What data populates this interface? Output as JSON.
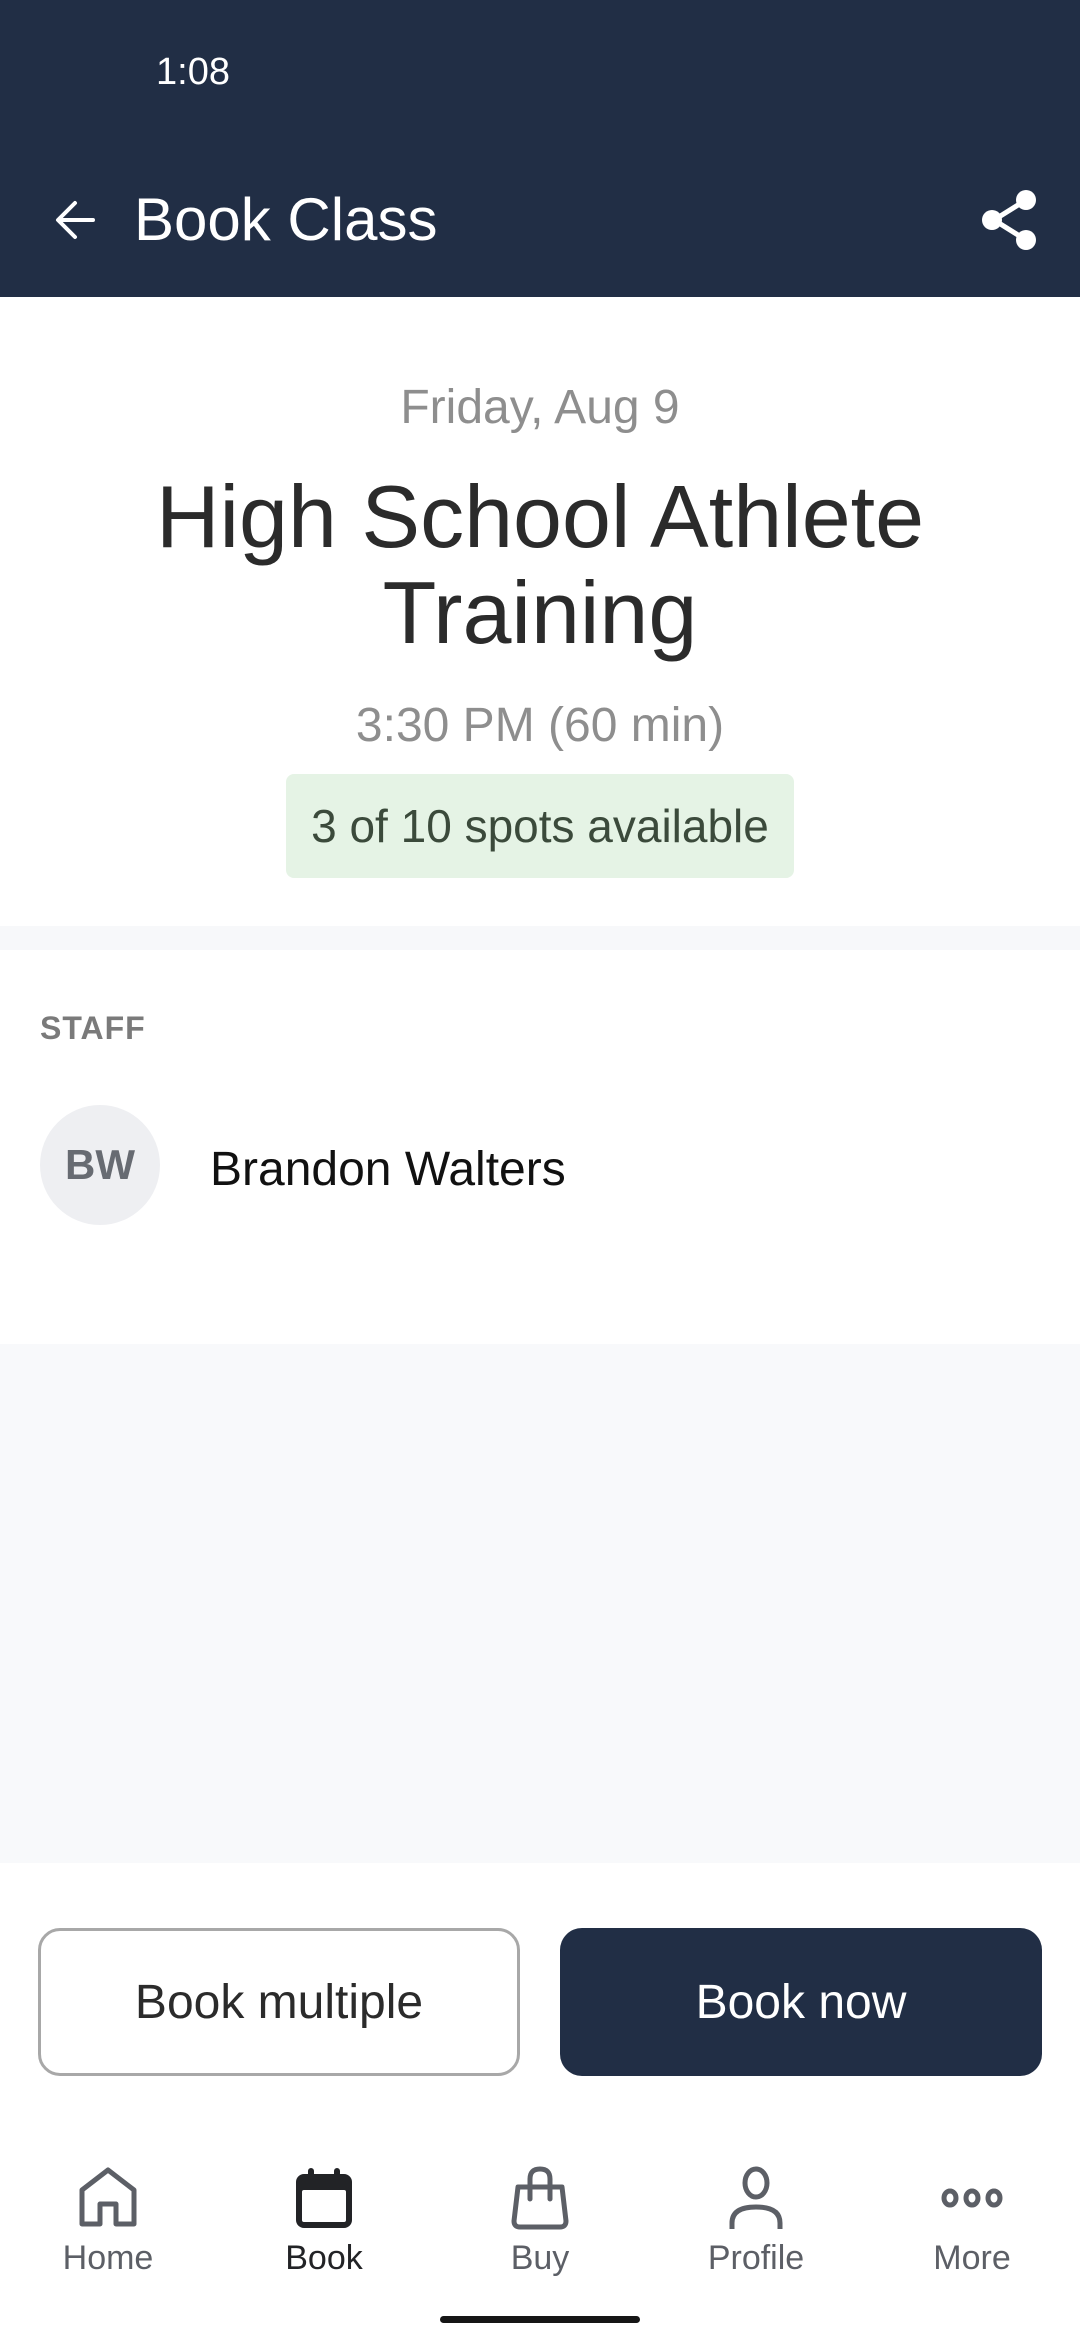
{
  "status_bar": {
    "time": "1:08"
  },
  "app_bar": {
    "title": "Book Class",
    "back_icon": "arrow-left-icon",
    "share_icon": "share-icon"
  },
  "class_info": {
    "date": "Friday, Aug 9",
    "title": "High School Athlete Training",
    "time": "3:30 PM (60 min)",
    "spots": {
      "label": "3 of 10 spots available",
      "available": 3,
      "total": 10
    }
  },
  "staff": {
    "heading": "STAFF",
    "members": [
      {
        "initials": "BW",
        "name": "Brandon Walters"
      }
    ]
  },
  "actions": {
    "book_multiple_label": "Book multiple",
    "book_now_label": "Book now"
  },
  "bottom_nav": {
    "items": [
      {
        "label": "Home",
        "icon": "home-icon",
        "active": false
      },
      {
        "label": "Book",
        "icon": "calendar-icon",
        "active": true
      },
      {
        "label": "Buy",
        "icon": "shopping-bag-icon",
        "active": false
      },
      {
        "label": "Profile",
        "icon": "person-icon",
        "active": false
      },
      {
        "label": "More",
        "icon": "more-dots-icon",
        "active": false
      }
    ]
  },
  "colors": {
    "brand_navy": "#212E45",
    "badge_green_bg": "#E5F3E5",
    "muted_text": "#8E8E8E",
    "page_gray": "#F8F9FB"
  }
}
